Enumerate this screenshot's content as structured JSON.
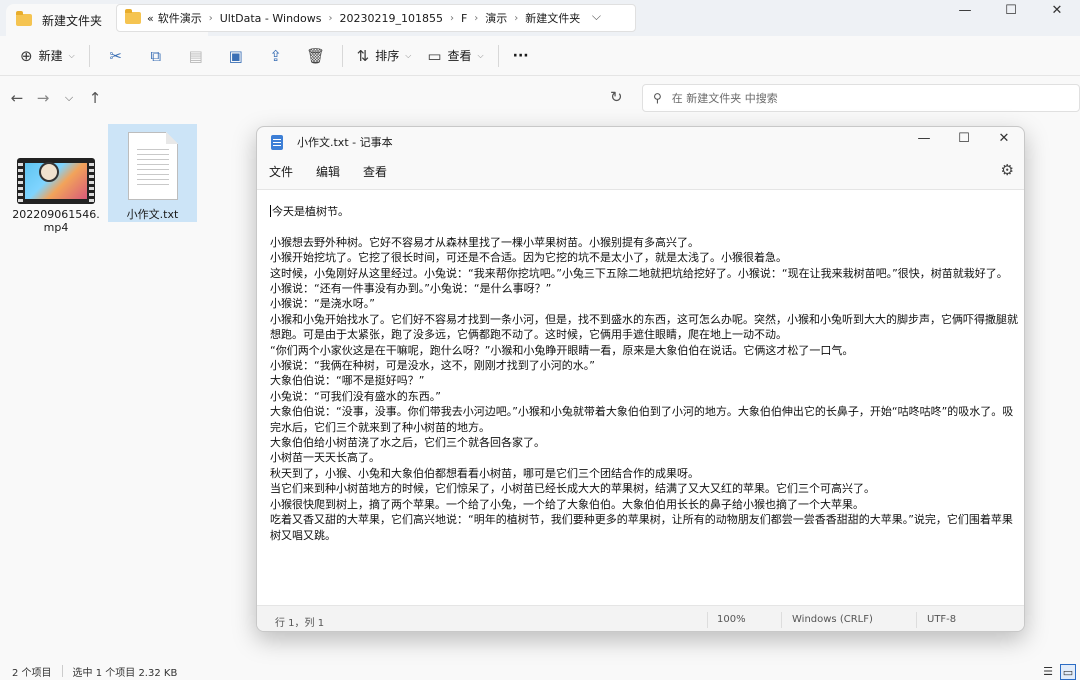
{
  "explorer": {
    "tab_title": "新建文件夹",
    "tab_close": "✕",
    "new_tab": "+",
    "window_controls": [
      "—",
      "☐",
      "✕"
    ],
    "commands": {
      "new_label": "新建",
      "sort_label": "排序",
      "view_label": "查看",
      "more_label": "···"
    },
    "breadcrumbs": [
      "«",
      "软件演示",
      "UltData - Windows",
      "20230219_101855",
      "F",
      "演示",
      "新建文件夹"
    ],
    "search_placeholder": "在 新建文件夹 中搜索",
    "files": [
      {
        "name": "202209061546.mp4",
        "type": "video"
      },
      {
        "name": "小作文.txt",
        "type": "text",
        "selected": true
      }
    ],
    "status": {
      "item_count": "2 个项目",
      "selection": "选中 1 个项目 2.32 KB"
    }
  },
  "notepad": {
    "title": "小作文.txt - 记事本",
    "menus": [
      "文件",
      "编辑",
      "查看"
    ],
    "content_lines": [
      "今天是植树节。",
      "",
      "小猴想去野外种树。它好不容易才从森林里找了一棵小苹果树苗。小猴别提有多高兴了。",
      "小猴开始挖坑了。它挖了很长时间，可还是不合适。因为它挖的坑不是太小了，就是太浅了。小猴很着急。",
      "这时候，小兔刚好从这里经过。小兔说：“我来帮你挖坑吧。”小兔三下五除二地就把坑给挖好了。小猴说：“现在让我来栽树苗吧。”很快，树苗就栽好了。",
      "小猴说：“还有一件事没有办到。”小兔说：“是什么事呀？”",
      "小猴说：“是浇水呀。”",
      "小猴和小兔开始找水了。它们好不容易才找到一条小河，但是，找不到盛水的东西，这可怎么办呢。突然，小猴和小兔听到大大的脚步声，它俩吓得撒腿就想跑。可是由于太紧张，跑了没多远，它俩都跑不动了。这时候，它俩用手遮住眼睛，爬在地上一动不动。",
      "“你们两个小家伙这是在干嘛呢，跑什么呀？”小猴和小兔睁开眼睛一看，原来是大象伯伯在说话。它俩这才松了一口气。",
      "小猴说：“我俩在种树，可是没水，这不，刚刚才找到了小河的水。”",
      "大象伯伯说：“哪不是挺好吗？”",
      "小兔说：“可我们没有盛水的东西。”",
      "大象伯伯说：“没事，没事。你们带我去小河边吧。”小猴和小兔就带着大象伯伯到了小河的地方。大象伯伯伸出它的长鼻子，开始“咕咚咕咚”的吸水了。吸完水后，它们三个就来到了种小树苗的地方。",
      "大象伯伯给小树苗浇了水之后，它们三个就各回各家了。",
      "小树苗一天天长高了。",
      "秋天到了，小猴、小兔和大象伯伯都想看看小树苗，哪可是它们三个团结合作的成果呀。",
      "当它们来到种小树苗地方的时候，它们惊呆了，小树苗已经长成大大的苹果树，结满了又大又红的苹果。它们三个可高兴了。",
      "小猴很快爬到树上，摘了两个苹果。一个给了小兔，一个给了大象伯伯。大象伯伯用长长的鼻子给小猴也摘了一个大苹果。",
      "吃着又香又甜的大苹果，它们高兴地说：“明年的植树节，我们要种更多的苹果树，让所有的动物朋友们都尝一尝香香甜甜的大苹果。”说完，它们围着苹果树又唱又跳。"
    ],
    "status": {
      "position": "行 1，列 1",
      "zoom": "100%",
      "line_ending": "Windows (CRLF)",
      "encoding": "UTF-8"
    }
  }
}
